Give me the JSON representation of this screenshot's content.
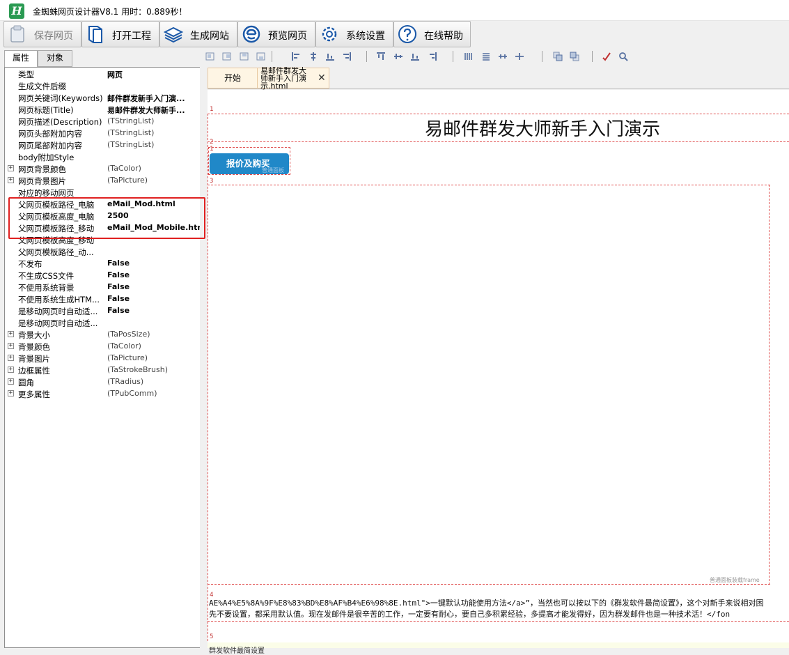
{
  "window": {
    "title": "金蜘蛛网页设计器V8.1 用时：0.889秒！",
    "logo_letter": "H"
  },
  "toolbar": {
    "buttons": [
      {
        "label": "保存网页",
        "icon": "save-icon",
        "enabled": false
      },
      {
        "label": "打开工程",
        "icon": "book-icon",
        "enabled": true
      },
      {
        "label": "生成网站",
        "icon": "layers-icon",
        "enabled": true
      },
      {
        "label": "预览网页",
        "icon": "ie-browser-icon",
        "enabled": true
      },
      {
        "label": "系统设置",
        "icon": "gear-icon",
        "enabled": true
      },
      {
        "label": "在线帮助",
        "icon": "help-icon",
        "enabled": true
      }
    ]
  },
  "left_tabs": [
    {
      "label": "属性",
      "active": true
    },
    {
      "label": "对象",
      "active": false
    }
  ],
  "properties": [
    {
      "name": "类型",
      "value": "网页",
      "bold": true,
      "expandable": false
    },
    {
      "name": "生成文件后缀",
      "value": "",
      "bold": false,
      "expandable": false
    },
    {
      "name": "网页关键词(Keywords)",
      "value": "邮件群发新手入门演...",
      "bold": true,
      "expandable": false
    },
    {
      "name": "网页标题(Title)",
      "value": "易邮件群发大师新手...",
      "bold": true,
      "expandable": false
    },
    {
      "name": "网页描述(Description)",
      "value": "(TStringList)",
      "bold": false,
      "expandable": false
    },
    {
      "name": "网页头部附加内容",
      "value": "(TStringList)",
      "bold": false,
      "expandable": false
    },
    {
      "name": "网页尾部附加内容",
      "value": "(TStringList)",
      "bold": false,
      "expandable": false
    },
    {
      "name": "body附加Style",
      "value": "",
      "bold": false,
      "expandable": false
    },
    {
      "name": "网页背景颜色",
      "value": "(TaColor)",
      "bold": false,
      "expandable": true
    },
    {
      "name": "网页背景图片",
      "value": "(TaPicture)",
      "bold": false,
      "expandable": true
    },
    {
      "name": "对应的移动网页",
      "value": "",
      "bold": false,
      "expandable": false
    },
    {
      "name": "父网页模板路径_电脑",
      "value": "eMail_Mod.html",
      "bold": true,
      "expandable": false
    },
    {
      "name": "父网页模板高度_电脑",
      "value": "2500",
      "bold": true,
      "expandable": false
    },
    {
      "name": "父网页模板路径_移动",
      "value": "eMail_Mod_Mobile.html",
      "bold": true,
      "expandable": false
    },
    {
      "name": "父网页模板高度_移动",
      "value": "",
      "bold": false,
      "expandable": false
    },
    {
      "name": "父网页模板路径_动...",
      "value": "",
      "bold": false,
      "expandable": false
    },
    {
      "name": "不发布",
      "value": "False",
      "bold": true,
      "expandable": false
    },
    {
      "name": "不生成CSS文件",
      "value": "False",
      "bold": true,
      "expandable": false
    },
    {
      "name": "不使用系统背景",
      "value": "False",
      "bold": true,
      "expandable": false
    },
    {
      "name": "不使用系统生成HTM...",
      "value": "False",
      "bold": true,
      "expandable": false
    },
    {
      "name": "是移动网页时自动适...",
      "value": "False",
      "bold": true,
      "expandable": false
    },
    {
      "name": "是移动网页时自动适...",
      "value": "",
      "bold": false,
      "expandable": false
    },
    {
      "name": "背景大小",
      "value": "(TaPosSize)",
      "bold": false,
      "expandable": true
    },
    {
      "name": "背景颜色",
      "value": "(TaColor)",
      "bold": false,
      "expandable": true
    },
    {
      "name": "背景图片",
      "value": "(TaPicture)",
      "bold": false,
      "expandable": true
    },
    {
      "name": "边框属性",
      "value": "(TaStrokeBrush)",
      "bold": false,
      "expandable": true
    },
    {
      "name": "圆角",
      "value": "(TRadius)",
      "bold": false,
      "expandable": true
    },
    {
      "name": "更多属性",
      "value": "(TPubComm)",
      "bold": false,
      "expandable": true
    }
  ],
  "doc_tabs": {
    "start_label": "开始",
    "file_label": "易邮件群发大师新手入门演示.html",
    "close_glyph": "✕"
  },
  "canvas": {
    "page_title": "易邮件群发大师新手入门演示",
    "buy_button_label": "报价及购买",
    "buy_button_sub": "普通面板",
    "panel_caption": "普通面板装载frame",
    "row_numbers": [
      "1",
      "2",
      "1",
      "3",
      "4",
      "5"
    ],
    "code_line_1": "AE%A4%E5%8A%9F%E8%83%BD%E8%AF%B4%E6%98%8E.html\">一键默认功能使用方法</a>”，当然也可以按以下的《群发软件最简设置》，这个对新手来说相对困",
    "code_line_2": "先不要设置，都采用默认值。现在发邮件是很辛苦的工作，一定要有耐心，要自己多积累经验，多提高才能发得好，因为群发邮件也是一种技术活！</fon",
    "bottom_text": "群发软件最简设置"
  },
  "colors": {
    "accent_green": "#2a9a52",
    "button_blue": "#2088c8",
    "highlight_red": "#e02020",
    "guide_red": "#e05050"
  }
}
